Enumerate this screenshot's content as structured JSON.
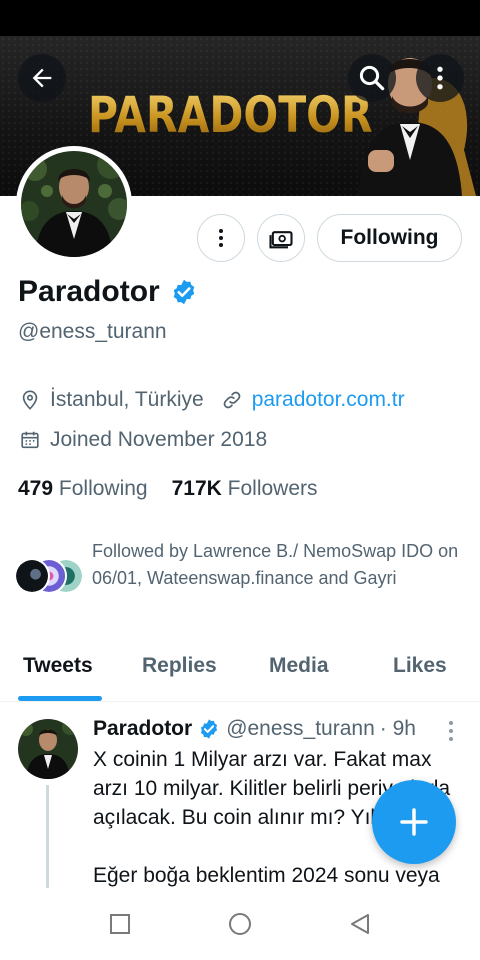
{
  "header": {
    "banner_text": "PARADOTOR",
    "icons": {
      "back": "arrow-left-icon",
      "search": "search-icon",
      "more": "more-vertical-icon"
    }
  },
  "profile": {
    "display_name": "Paradotor",
    "verified": true,
    "handle": "@eness_turann",
    "location": "İstanbul, Türkiye",
    "website": "paradotor.com.tr",
    "joined": "Joined November 2018",
    "following_count": "479",
    "following_label": "Following",
    "followers_count": "717K",
    "followers_label": "Followers",
    "followed_by": "Followed by Lawrence B./ NemoSwap IDO on 06/01, Wateenswap.finance and Gayri"
  },
  "actions": {
    "following_button": "Following",
    "icons": {
      "more": "more-vertical-icon",
      "tip": "money-icon"
    }
  },
  "tabs": [
    {
      "label": "Tweets",
      "active": true
    },
    {
      "label": "Replies",
      "active": false
    },
    {
      "label": "Media",
      "active": false
    },
    {
      "label": "Likes",
      "active": false
    }
  ],
  "tweet": {
    "author_name": "Paradotor",
    "author_handle": "@eness_turann",
    "time": "· 9h",
    "body": "X coinin 1 Milyar arzı var. Fakat max arzı 10 milyar. Kilitler belirli periyotlarla açılacak. Bu coin alınır mı? Yılda\n\nEğer boğa beklentim 2024 sonu veya"
  },
  "colors": {
    "accent": "#1d9bf0",
    "text_primary": "#0f1419",
    "text_secondary": "#536471",
    "banner_gold": "#d8a93b"
  }
}
